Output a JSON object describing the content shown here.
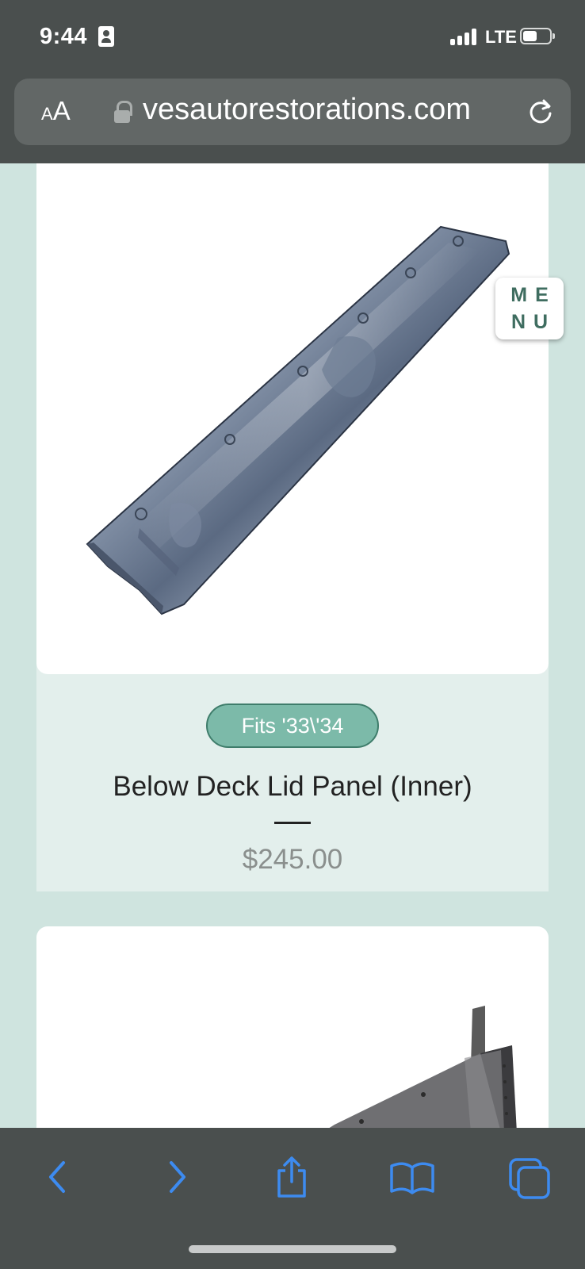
{
  "status_bar": {
    "time": "9:44",
    "network": "LTE"
  },
  "browser": {
    "reader_label_small": "A",
    "reader_label_large": "A",
    "url": "vesautorestorations.com"
  },
  "menu": {
    "line1": "ME",
    "line2": "NU"
  },
  "product": {
    "fits_label": "Fits '33\\'34",
    "title": "Below Deck Lid Panel (Inner)",
    "price": "$245.00"
  },
  "toolbar": {
    "icons": [
      "back-icon",
      "forward-icon",
      "share-icon",
      "bookmarks-icon",
      "tabs-icon"
    ]
  },
  "colors": {
    "page_background": "#cfe4df",
    "badge_fill": "#7cbaa9",
    "menu_text": "#3f6d60",
    "toolbar_accent": "#3d8bf0"
  }
}
